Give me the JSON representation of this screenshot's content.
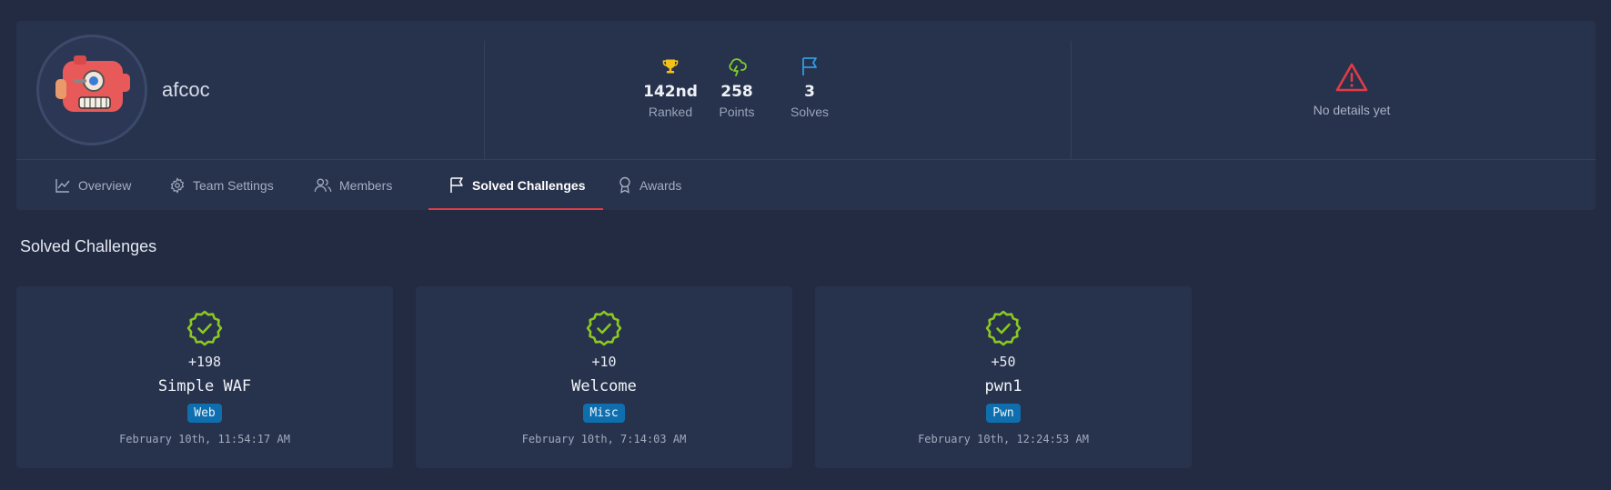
{
  "team": {
    "name": "afcoc"
  },
  "stats": [
    {
      "icon": "trophy-icon",
      "value": "142nd",
      "label": "Ranked",
      "color": "#f2c21b"
    },
    {
      "icon": "cloud-lightning-icon",
      "value": "258",
      "label": "Points",
      "color": "#7ccf2a"
    },
    {
      "icon": "flag-icon",
      "value": "3",
      "label": "Solves",
      "color": "#2f9be0"
    }
  ],
  "details": {
    "icon": "warning-icon",
    "text": "No details yet",
    "color": "#e23b46"
  },
  "tabs": [
    {
      "label": "Overview",
      "icon": "chart-line-icon",
      "active": false
    },
    {
      "label": "Team Settings",
      "icon": "gear-icon",
      "active": false
    },
    {
      "label": "Members",
      "icon": "users-icon",
      "active": false
    },
    {
      "label": "Solved Challenges",
      "icon": "flag-icon",
      "active": true
    },
    {
      "label": "Awards",
      "icon": "award-icon",
      "active": false
    }
  ],
  "section": {
    "title": "Solved Challenges"
  },
  "challenges": [
    {
      "points": "+198",
      "name": "Simple WAF",
      "category": "Web",
      "date": "February 10th, 11:54:17 AM"
    },
    {
      "points": "+10",
      "name": "Welcome",
      "category": "Misc",
      "date": "February 10th, 7:14:03 AM"
    },
    {
      "points": "+50",
      "name": "pwn1",
      "category": "Pwn",
      "date": "February 10th, 12:24:53 AM"
    }
  ],
  "colors": {
    "background": "#222b42",
    "card": "#27324d",
    "accent_active_tab": "#e23b46",
    "solved_check": "#8bc820",
    "badge": "#0f6fae"
  }
}
